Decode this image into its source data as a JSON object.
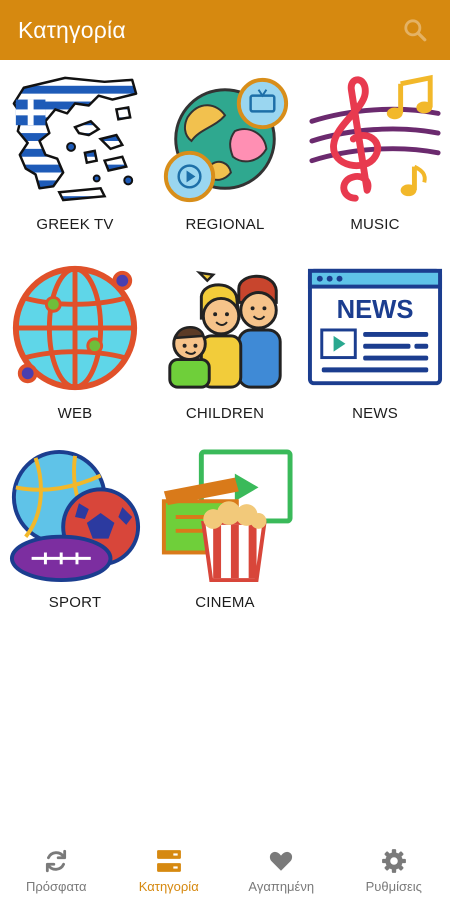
{
  "appbar": {
    "title": "Κατηγορία",
    "search_icon": "search-icon"
  },
  "categories": [
    {
      "label": "GREEK TV",
      "icon": "greece-map-icon"
    },
    {
      "label": "REGIONAL",
      "icon": "regional-globe-icon"
    },
    {
      "label": "MUSIC",
      "icon": "music-notes-icon"
    },
    {
      "label": "WEB",
      "icon": "web-globe-icon"
    },
    {
      "label": "CHILDREN",
      "icon": "children-icon"
    },
    {
      "label": "NEWS",
      "icon": "news-icon"
    },
    {
      "label": "SPORT",
      "icon": "sport-balls-icon"
    },
    {
      "label": "CINEMA",
      "icon": "cinema-icon"
    }
  ],
  "bottom_nav": {
    "active_index": 1,
    "items": [
      {
        "label": "Πρόσφατα",
        "icon": "refresh-icon"
      },
      {
        "label": "Κατηγορία",
        "icon": "category-list-icon"
      },
      {
        "label": "Αγαπημένη",
        "icon": "heart-icon"
      },
      {
        "label": "Ρυθμίσεις",
        "icon": "gear-icon"
      }
    ]
  },
  "colors": {
    "accent": "#d68910",
    "nav_inactive": "#7a7a7a",
    "background": "#ffffff"
  }
}
